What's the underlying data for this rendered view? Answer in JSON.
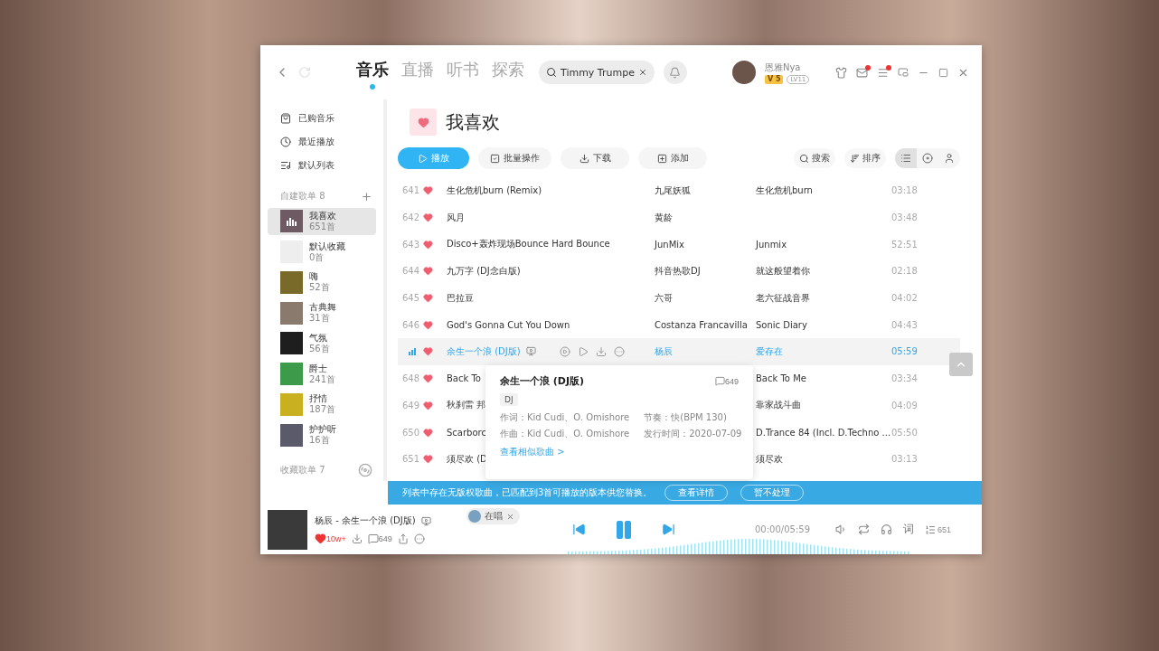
{
  "nav": {
    "tabs": [
      {
        "label": "音乐",
        "selected": true
      },
      {
        "label": "直播",
        "selected": false
      },
      {
        "label": "听书",
        "selected": false
      },
      {
        "label": "探索",
        "selected": false
      }
    ]
  },
  "search": {
    "value": "Timmy Trumpe"
  },
  "user": {
    "name": "恩雅Nya",
    "vip": "V 5",
    "level": "LV11"
  },
  "sidebar": {
    "links": [
      "已购音乐",
      "最近播放",
      "默认列表"
    ],
    "created": {
      "title": "自建歌单 8",
      "items": [
        {
          "name": "我喜欢",
          "count": "651首",
          "selected": true,
          "kind": "liked"
        },
        {
          "name": "默认收藏",
          "count": "0首",
          "selected": false,
          "kind": "empty"
        },
        {
          "name": "嗨",
          "count": "52首",
          "selected": false,
          "kind": "cover",
          "color": "#7a6a2a"
        },
        {
          "name": "古典舞",
          "count": "31首",
          "selected": false,
          "kind": "cover",
          "color": "#8a7a6e"
        },
        {
          "name": "气氛",
          "count": "56首",
          "selected": false,
          "kind": "cover",
          "color": "#1e1e1e"
        },
        {
          "name": "爵士",
          "count": "241首",
          "selected": false,
          "kind": "cover",
          "color": "#3c9a4a"
        },
        {
          "name": "抒情",
          "count": "187首",
          "selected": false,
          "kind": "cover",
          "color": "#c8b020"
        },
        {
          "name": "护护听",
          "count": "16首",
          "selected": false,
          "kind": "cover",
          "color": "#5a5a6a"
        }
      ]
    },
    "collected": {
      "title": "收藏歌单 7"
    }
  },
  "playlist": {
    "title": "我喜欢",
    "actions": [
      {
        "label": "播放",
        "kind": "play"
      },
      {
        "label": "批量操作",
        "kind": "batch"
      },
      {
        "label": "下载",
        "kind": "download"
      },
      {
        "label": "添加",
        "kind": "add"
      }
    ],
    "tools": [
      {
        "label": "搜索",
        "kind": "search"
      },
      {
        "label": "排序",
        "kind": "sort"
      }
    ],
    "views": [
      {
        "kind": "list",
        "selected": true
      },
      {
        "kind": "disc",
        "selected": false
      },
      {
        "kind": "artist",
        "selected": false
      }
    ],
    "rows": [
      {
        "number": "641",
        "title": "生化危机burn (Remix)",
        "artist": "九尾妖狐",
        "album": "生化危机burn",
        "duration": "03:18",
        "selected": false
      },
      {
        "number": "642",
        "title": "风月",
        "artist": "黄龄",
        "album": "",
        "duration": "03:48",
        "selected": false
      },
      {
        "number": "643",
        "title": "Disco+轰炸现场Bounce Hard Bounce",
        "artist": "JunMix",
        "album": "Junmix",
        "duration": "52:51",
        "selected": false
      },
      {
        "number": "644",
        "title": "九万字 (DJ念白版)",
        "artist": "抖音热歌DJ",
        "album": "就这般望着你",
        "duration": "02:18",
        "selected": false
      },
      {
        "number": "645",
        "title": "巴拉豆",
        "artist": "六哥",
        "album": "老六征战音界",
        "duration": "04:02",
        "selected": false
      },
      {
        "number": "646",
        "title": "God's Gonna Cut You Down",
        "artist": "Costanza Francavilla",
        "album": "Sonic Diary",
        "duration": "04:43",
        "selected": false
      },
      {
        "number": "",
        "title": "余生一个浪 (DJ版)",
        "artist": "杨辰",
        "album": "爱存在",
        "duration": "05:59",
        "selected": true
      },
      {
        "number": "648",
        "title": "Back To",
        "artist": "",
        "album": "Back To Me",
        "duration": "03:34",
        "selected": false
      },
      {
        "number": "649",
        "title": "秋刹雷 邦",
        "artist": "",
        "album": "靠家战斗曲",
        "duration": "04:09",
        "selected": false
      },
      {
        "number": "650",
        "title": "Scarborc",
        "artist": "",
        "album": "D.Trance 84 (Incl. D.Techno ...",
        "duration": "05:50",
        "selected": false
      },
      {
        "number": "651",
        "title": "须尽欢 (D",
        "artist": "",
        "album": "须尽欢",
        "duration": "03:13",
        "selected": false
      }
    ]
  },
  "popup": {
    "title": "余生一个浪 (DJ版)",
    "comments": "649",
    "tag": "DJ",
    "lyricist": "作词：Kid Cudi、O. Omishore",
    "composer": "作曲：Kid Cudi、O. Omishore",
    "tempo": "节奏：快(BPM 130)",
    "release": "发行时间：2020-07-09",
    "link": "查看相似歌曲 >"
  },
  "banner": {
    "text": "列表中存在无版权歌曲，已匹配到3首可播放的版本供您替换。",
    "buttons": [
      "查看详情",
      "暂不处理"
    ]
  },
  "player": {
    "song": "杨辰 - 余生一个浪 (DJ版)",
    "chip": "在唱",
    "likes": "10w+",
    "comments": "649",
    "playing": true,
    "time": "00:00/05:59",
    "lyrics": "词",
    "queue": "651"
  }
}
